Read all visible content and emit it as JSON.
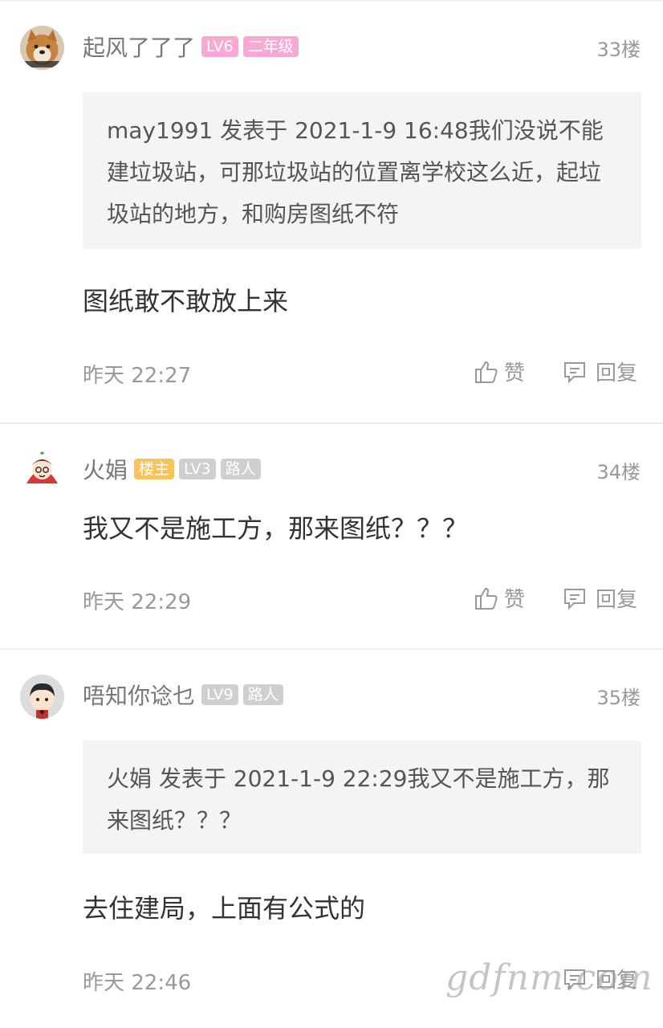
{
  "posts": [
    {
      "author": "起风了了了",
      "badges": [
        "LV6",
        "二年级"
      ],
      "floor": "33楼",
      "quote": "may1991 发表于 2021-1-9 16:48我们没说不能建垃圾站，可那垃圾站的位置离学校这么近，起垃圾站的地方，和购房图纸不符",
      "content": "图纸敢不敢放上来",
      "time": "昨天 22:27",
      "like_label": "赞",
      "reply_label": "回复"
    },
    {
      "author": "火娟",
      "badges": [
        "楼主",
        "LV3",
        "路人"
      ],
      "floor": "34楼",
      "content": "我又不是施工方，那来图纸？？？",
      "time": "昨天 22:29",
      "like_label": "赞",
      "reply_label": "回复"
    },
    {
      "author": "唔知你谂乜",
      "badges": [
        "LV9",
        "路人"
      ],
      "floor": "35楼",
      "quote": "火娟 发表于 2021-1-9 22:29我又不是施工方，那来图纸？？？",
      "content": "去住建局，上面有公式的",
      "time": "昨天 22:46",
      "like_label": "",
      "reply_label": "回复"
    }
  ],
  "watermark": "gdfnm.com",
  "colors": {
    "badge_pink": "#f7a9d4",
    "badge_gray": "#cfcfcf",
    "badge_gold": "#f6c45a"
  }
}
